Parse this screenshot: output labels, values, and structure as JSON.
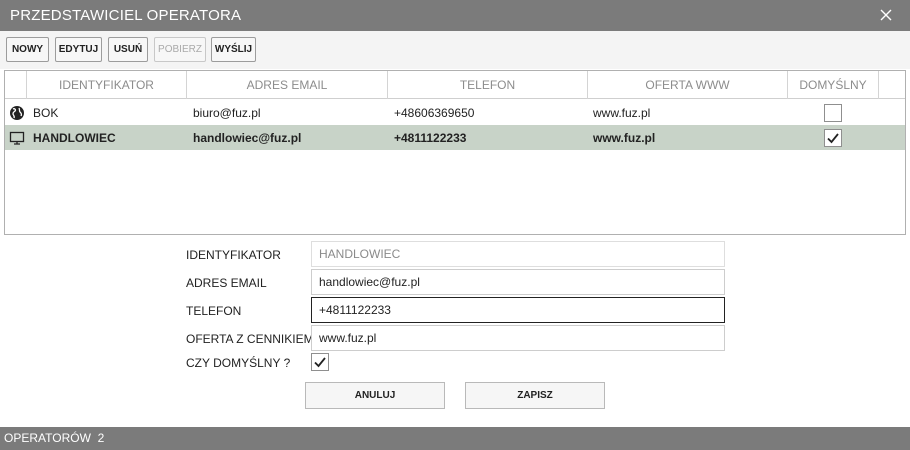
{
  "window": {
    "title": "PRZEDSTAWICIEL OPERATORA",
    "close_icon": "close-icon"
  },
  "toolbar": {
    "new_label": "NOWY",
    "edit_label": "EDYTUJ",
    "delete_label": "USUŃ",
    "fetch_label": "POBIERZ",
    "send_label": "WYŚLIJ"
  },
  "grid": {
    "columns": [
      "IDENTYFIKATOR",
      "ADRES EMAIL",
      "TELEFON",
      "OFERTA WWW",
      "DOMYŚLNY"
    ],
    "rows": [
      {
        "icon": "globe-icon",
        "id": "BOK",
        "email": "biuro@fuz.pl",
        "phone": "+48606369650",
        "www": "www.fuz.pl",
        "default": false,
        "selected": false
      },
      {
        "icon": "monitor-icon",
        "id": "HANDLOWIEC",
        "email": "handlowiec@fuz.pl",
        "phone": "+4811122233",
        "www": "www.fuz.pl",
        "default": true,
        "selected": true
      }
    ]
  },
  "form": {
    "identifier_label": "IDENTYFIKATOR",
    "identifier_value": "HANDLOWIEC",
    "email_label": "ADRES EMAIL",
    "email_value": "handlowiec@fuz.pl",
    "phone_label": "TELEFON",
    "phone_value": "+4811122233",
    "offer_label": "OFERTA Z CENNIKIEM",
    "offer_value": "www.fuz.pl",
    "default_label": "CZY DOMYŚLNY ?",
    "default_checked": true,
    "cancel_label": "ANULUJ",
    "save_label": "ZAPISZ"
  },
  "status": {
    "text": "OPERATORÓW  2"
  },
  "colors": {
    "titlebar": "#7b7b7b",
    "selected_row": "#c8d3c8"
  }
}
